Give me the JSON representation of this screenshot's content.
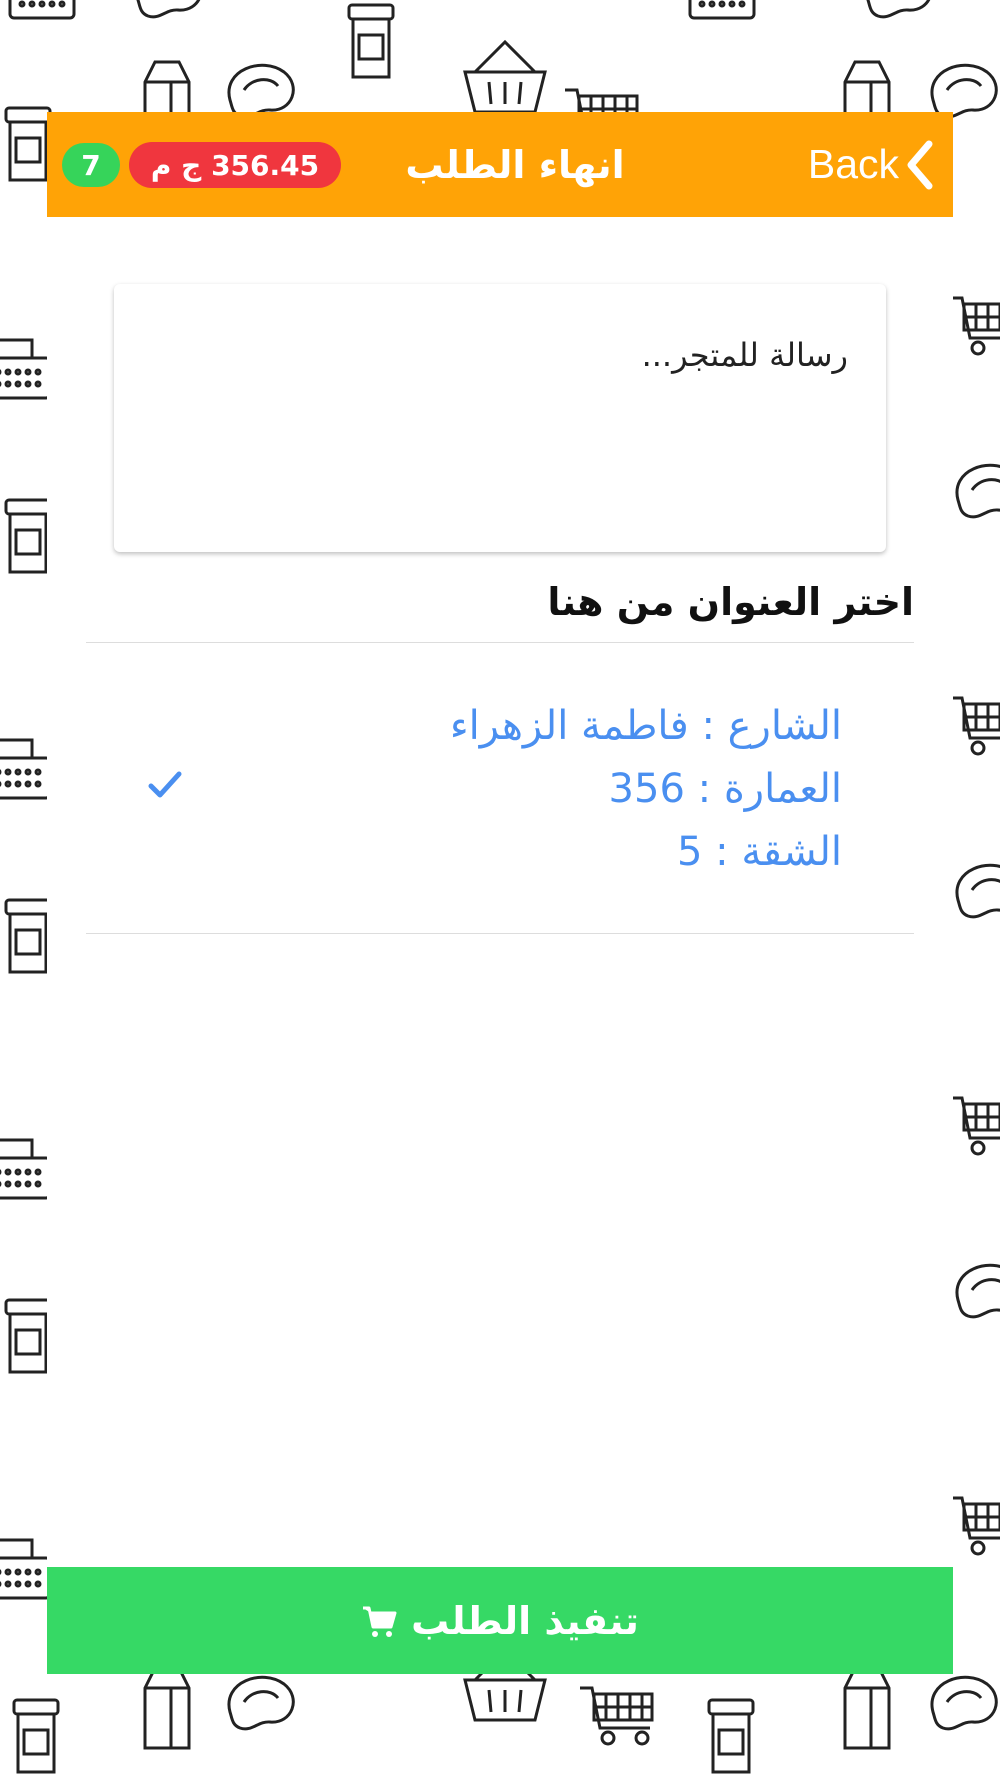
{
  "header": {
    "back_label": "Back",
    "title": "انهاء الطلب",
    "cart_total": "356.45 ج م",
    "cart_count": "7"
  },
  "message": {
    "placeholder": "رسالة للمتجر..."
  },
  "address_section": {
    "title": "اختر العنوان من هنا",
    "addresses": [
      {
        "street": "الشارع : فاطمة الزهراء",
        "building": "العمارة : 356",
        "apartment": "الشقة : 5",
        "selected": true
      }
    ]
  },
  "submit": {
    "label": "تنفيذ الطلب",
    "icon": "cart-icon"
  },
  "colors": {
    "header": "#ffa306",
    "price_badge": "#f0363e",
    "count_badge": "#36d45a",
    "address_text": "#4a8ff0",
    "submit_button": "#36d965"
  },
  "background_icons": [
    "milk-carton-icon",
    "steak-icon",
    "basket-icon",
    "shopping-cart-icon",
    "jar-icon",
    "cash-register-icon",
    "canned-food-icon",
    "fish-icon",
    "chicken-leg-icon"
  ]
}
